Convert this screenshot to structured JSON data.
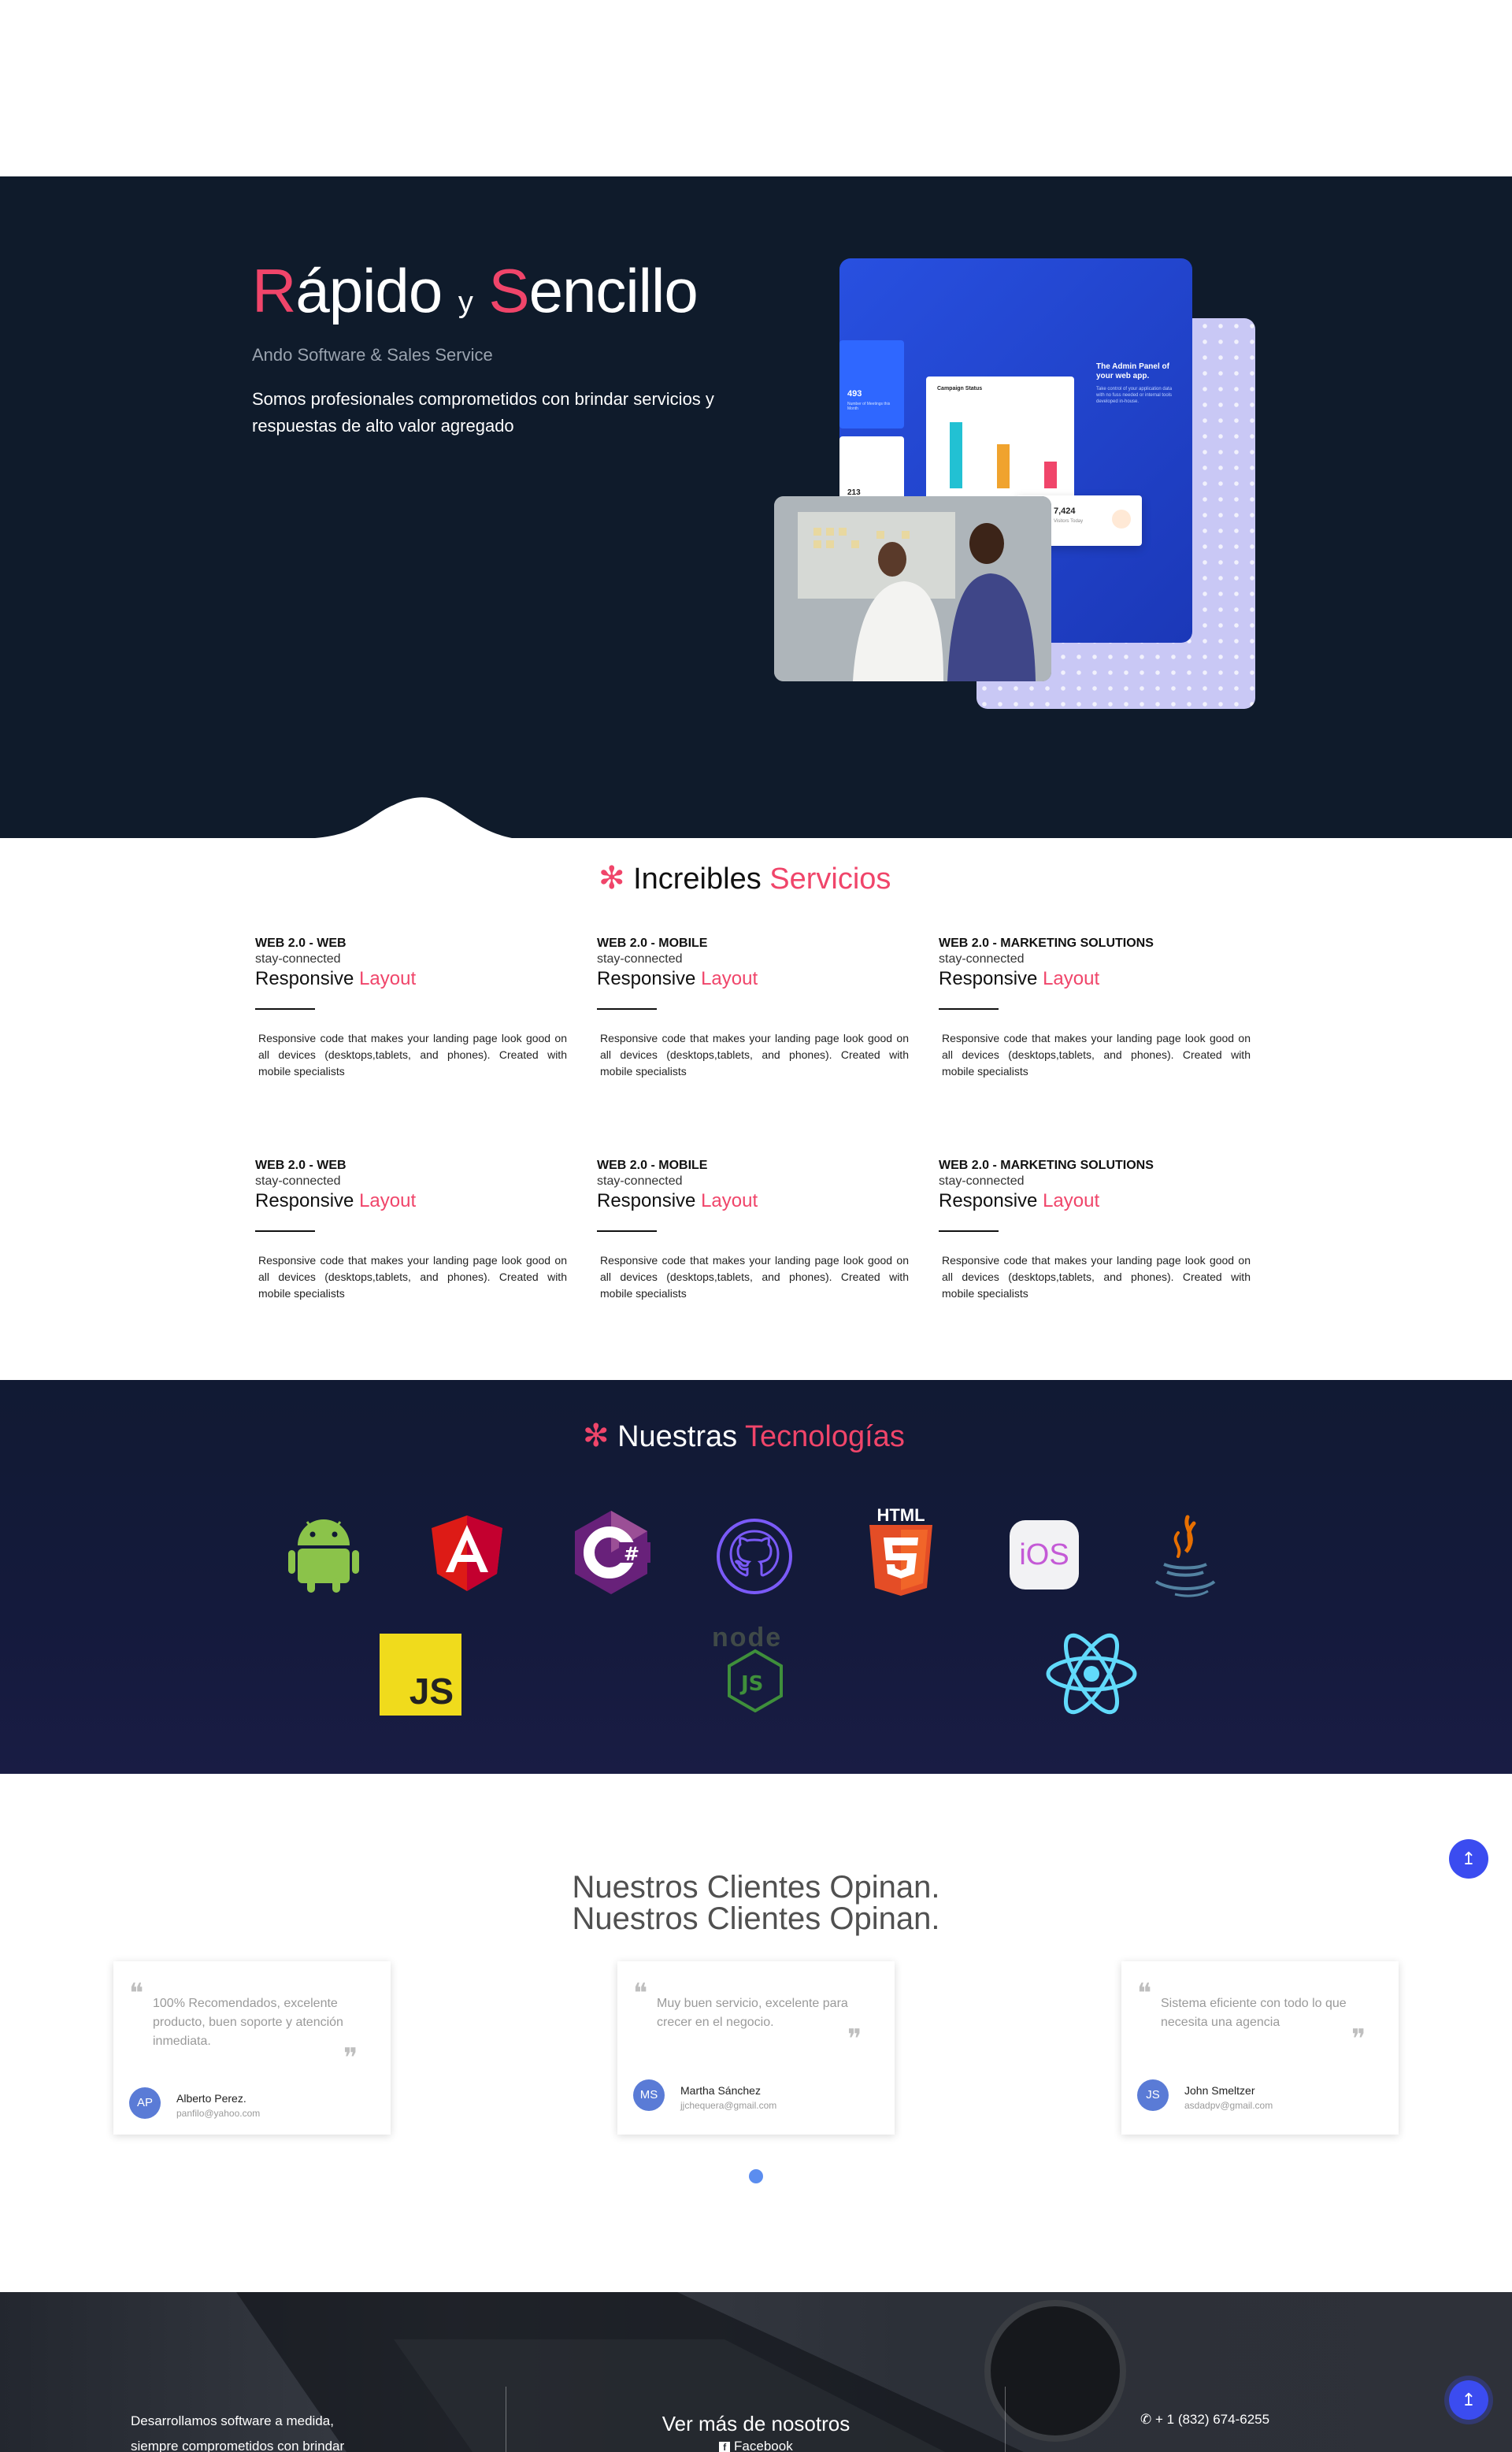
{
  "hero": {
    "title_r": "R",
    "title_rest1": "ápido",
    "title_y": "y",
    "title_s": "S",
    "title_rest2": "encillo",
    "subtitle": "Ando Software & Sales Service",
    "description": "Somos profesionales comprometidos con brindar servicios y respuestas de alto valor agregado",
    "mockup": {
      "panel_title": "The Admin Panel of your web app.",
      "panel_text": "Take control of your application data with no fuss needed or internal tools developed in-house.",
      "stat1": "493",
      "stat1_label": "Number of Meetings this Month",
      "stat2": "213",
      "chart_title": "Campaign Status",
      "stat3": "7,424",
      "stat3_label": "Visitors Today"
    }
  },
  "services": {
    "title_a": "Increibles",
    "title_b": "Servicios",
    "items": [
      {
        "category": "WEB 2.0 - WEB",
        "img_alt": "stay-connected",
        "title_a": "Responsive",
        "title_b": "Layout",
        "desc": "Responsive code that makes your landing page look good on all devices (desktops,tablets, and phones). Created with mobile specialists"
      },
      {
        "category": "WEB 2.0 - MOBILE",
        "img_alt": "stay-connected",
        "title_a": "Responsive",
        "title_b": "Layout",
        "desc": "Responsive code that makes your landing page look good on all devices (desktops,tablets, and phones). Created with mobile specialists"
      },
      {
        "category": "WEB 2.0 - MARKETING SOLUTIONS",
        "img_alt": "stay-connected",
        "title_a": "Responsive",
        "title_b": "Layout",
        "desc": "Responsive code that makes your landing page look good on all devices (desktops,tablets, and phones). Created with mobile specialists"
      },
      {
        "category": "WEB 2.0 - WEB",
        "img_alt": "stay-connected",
        "title_a": "Responsive",
        "title_b": "Layout",
        "desc": "Responsive code that makes your landing page look good on all devices (desktops,tablets, and phones). Created with mobile specialists"
      },
      {
        "category": "WEB 2.0 - MOBILE",
        "img_alt": "stay-connected",
        "title_a": "Responsive",
        "title_b": "Layout",
        "desc": "Responsive code that makes your landing page look good on all devices (desktops,tablets, and phones). Created with mobile specialists"
      },
      {
        "category": "WEB 2.0 - MARKETING SOLUTIONS",
        "img_alt": "stay-connected",
        "title_a": "Responsive",
        "title_b": "Layout",
        "desc": "Responsive code that makes your landing page look good on all devices (desktops,tablets, and phones). Created with mobile specialists"
      }
    ]
  },
  "tech": {
    "title_a": "Nuestras",
    "title_b": "Tecnologías",
    "icons": [
      "android-icon",
      "angular-icon",
      "csharp-icon",
      "github-icon",
      "html5-icon",
      "ios-icon",
      "java-icon",
      "javascript-icon",
      "nodejs-icon",
      "react-icon"
    ],
    "html5_label": "HTML",
    "ios_label": "iOS",
    "js_label": "JS",
    "node_label": "node"
  },
  "clients": {
    "title_line1": "Nuestros Clientes Opinan.",
    "title_line2": "Nuestros Clientes Opinan.",
    "testimonials": [
      {
        "text": "100% Recomendados, excelente producto, buen soporte y atención inmediata.",
        "initials": "AP",
        "name": "Alberto Perez.",
        "email": "panfilo@yahoo.com"
      },
      {
        "text": "Muy buen servicio, excelente para crecer en el negocio.",
        "initials": "MS",
        "name": "Martha Sánchez",
        "email": "jjchequera@gmail.com"
      },
      {
        "text": "Sistema eficiente con todo lo que necesita una agencia",
        "initials": "JS",
        "name": "John Smeltzer",
        "email": "asdadpv@gmail.com"
      }
    ]
  },
  "fab": {
    "label": "↥"
  },
  "footer": {
    "about_line1": "Desarrollamos software a medida,",
    "about_line2": "siempre comprometidos con brindar",
    "more_title": "Ver más de nosotros",
    "facebook": "Facebook",
    "phone": "+ 1 (832) 674-6255"
  },
  "colors": {
    "accent": "#f0456a",
    "hero_bg": "#0f1b2b",
    "fab": "#3b4cf0",
    "avatar": "#5a7bd6"
  }
}
